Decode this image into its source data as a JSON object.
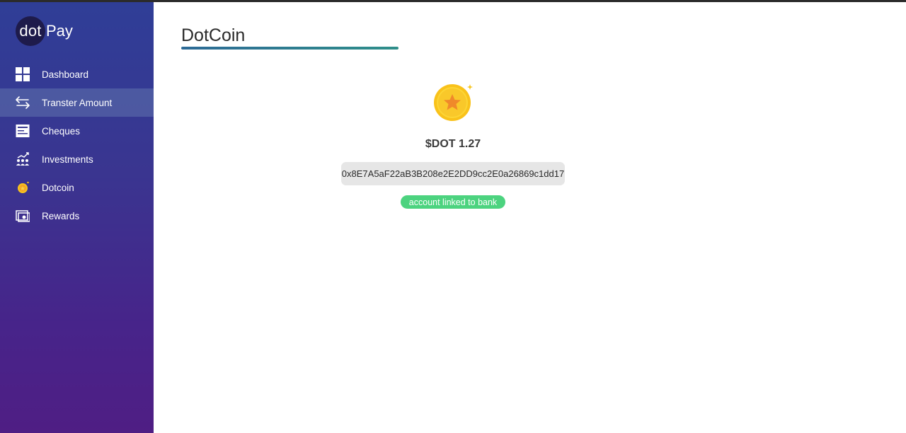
{
  "app": {
    "logo_dot": "dot",
    "logo_pay": "Pay"
  },
  "sidebar": {
    "items": [
      {
        "label": "Dashboard",
        "icon": "dashboard-grid-icon",
        "active": false
      },
      {
        "label": "Transter Amount",
        "icon": "transfer-arrows-icon",
        "active": true
      },
      {
        "label": "Cheques",
        "icon": "cheque-icon",
        "active": false
      },
      {
        "label": "Investments",
        "icon": "investments-chart-icon",
        "active": false
      },
      {
        "label": "Dotcoin",
        "icon": "coin-icon",
        "active": false
      },
      {
        "label": "Rewards",
        "icon": "rewards-icon",
        "active": false
      }
    ]
  },
  "main": {
    "title": "DotCoin",
    "balance": "$DOT 1.27",
    "address": "0x8E7A5aF22aB3B208e2E2DD9cc2E0a26869c1dd17",
    "status_badge": "account linked to bank",
    "coin_icon": "gold-star-coin-icon"
  },
  "colors": {
    "sidebar_top": "#2f3e97",
    "sidebar_bottom": "#4f1e84",
    "active_item": "#4a6a9c",
    "underline": "#2f8f8a",
    "badge": "#4cd37f",
    "coin_gold": "#f7c51e",
    "coin_star": "#f08a24"
  }
}
